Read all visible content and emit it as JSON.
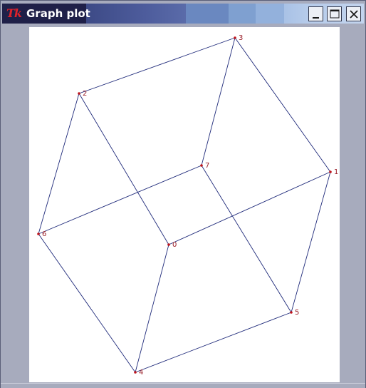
{
  "window": {
    "title": "Graph plot",
    "logo": "Tk",
    "buttons": {
      "minimize": "minimize-icon",
      "maximize": "maximize-icon",
      "close": "close-icon"
    }
  },
  "graph": {
    "nodes": [
      {
        "id": "0",
        "label": "0"
      },
      {
        "id": "1",
        "label": "1"
      },
      {
        "id": "2",
        "label": "2"
      },
      {
        "id": "3",
        "label": "3"
      },
      {
        "id": "4",
        "label": "4"
      },
      {
        "id": "5",
        "label": "5"
      },
      {
        "id": "6",
        "label": "6"
      },
      {
        "id": "7",
        "label": "7"
      }
    ],
    "edges": [
      [
        "0",
        "1"
      ],
      [
        "0",
        "2"
      ],
      [
        "0",
        "4"
      ],
      [
        "1",
        "3"
      ],
      [
        "1",
        "5"
      ],
      [
        "2",
        "3"
      ],
      [
        "2",
        "6"
      ],
      [
        "3",
        "7"
      ],
      [
        "4",
        "5"
      ],
      [
        "4",
        "6"
      ],
      [
        "5",
        "7"
      ],
      [
        "6",
        "7"
      ]
    ],
    "colors": {
      "edge": "#1f2a7a",
      "node": "#c0141b",
      "label": "#9a1e28"
    }
  }
}
